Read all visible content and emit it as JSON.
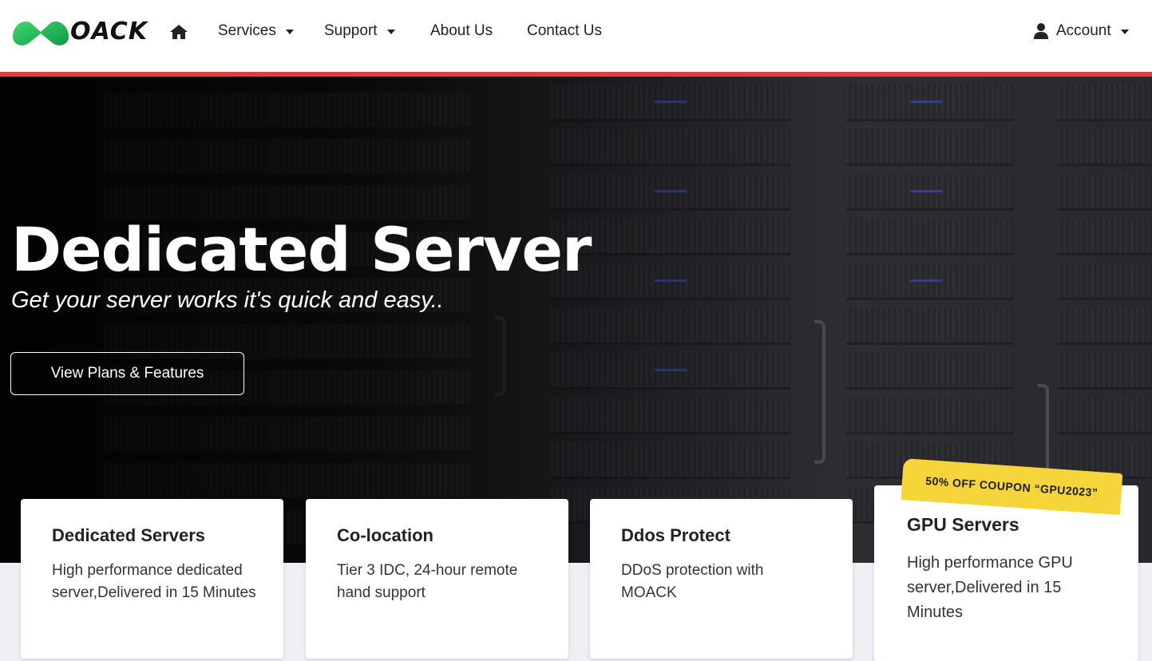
{
  "nav": {
    "logo_text": "OACK",
    "items": [
      {
        "label": "Services",
        "has_dropdown": true
      },
      {
        "label": "Support",
        "has_dropdown": true
      },
      {
        "label": "About Us",
        "has_dropdown": false
      },
      {
        "label": "Contact Us",
        "has_dropdown": false
      }
    ],
    "account_label": "Account",
    "accent_color": "#e0403a"
  },
  "hero": {
    "title": "Dedicated Server",
    "subtitle": "Get your server works it's quick and easy..",
    "cta_label": "View Plans & Features"
  },
  "cards": [
    {
      "title": "Dedicated Servers",
      "description": "High performance dedicated server,Delivered in 15 Minutes"
    },
    {
      "title": "Co-location",
      "description": "Tier 3 IDC, 24-hour remote hand support"
    },
    {
      "title": "Ddos Protect",
      "description": "DDoS protection with MOACK"
    },
    {
      "title": "GPU Servers",
      "description": "High performance GPU server,Delivered in 15 Minutes",
      "ribbon": "50% OFF COUPON “GPU2023”"
    }
  ],
  "colors": {
    "brand_green": "#1fb554",
    "ribbon_yellow": "#f5d53a"
  }
}
